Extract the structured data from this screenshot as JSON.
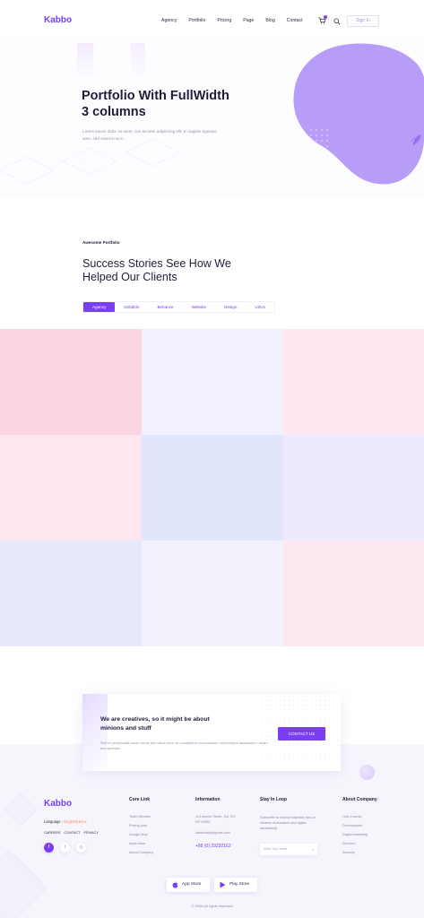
{
  "header": {
    "logo": "Kabbo",
    "nav": [
      "Agency",
      "Portfolio",
      "Pricing",
      "Page",
      "Blog",
      "Contact"
    ],
    "signin_label": "Sign In"
  },
  "hero": {
    "title": "Portfolio With FullWidth 3 columns",
    "description": "Lorem ipsum dolor sit amet, con sectetu adipiscing elit. In sagittis egestas ante, sed viverra nunc."
  },
  "portfolio": {
    "eyebrow": "Awesome Portfolio",
    "title": "Success Stories See How We Helped Our Clients",
    "filters": [
      "Agency",
      "Dribbble",
      "Behance",
      "Website",
      "Design",
      "UI/Ux"
    ],
    "active_filter": "Agency",
    "tiles": [
      "#fbd6e2",
      "#f0f1fc",
      "#fde6ee",
      "#fde6ef",
      "#e2e6fc",
      "#eee9fc",
      "#e6e8fc",
      "#f1f2fc",
      "#fde7ef"
    ]
  },
  "cta": {
    "title": "We are creatives, so it might be about minions and stuff",
    "description": "Sed ut perspiciatis unde omnis iste natus error sit voluptatem accusantium doloremque laudantium, totam rem aperiam",
    "button_label": "CONTACT US"
  },
  "footer": {
    "logo": "Kabbo",
    "language_label": "Language :",
    "language_value": "English(UK) ▾",
    "links": [
      "CAREERS",
      "CONTACT",
      "PRIVACY"
    ],
    "social": [
      {
        "icon": "facebook-icon",
        "glyph": "f"
      },
      {
        "icon": "twitter-icon",
        "glyph": "t"
      },
      {
        "icon": "instagram-icon",
        "glyph": "◎"
      }
    ],
    "core_link": {
      "title": "Core Link",
      "items": [
        "Team Member",
        "Pricing plan",
        "Google Map",
        "Apps store",
        "About Company"
      ]
    },
    "information": {
      "title": "Information",
      "address": "113 minnie Street, Sol 7Z3 NY 20052",
      "email": "kabbohelp@gmail.com",
      "phone": "+88 (0) 29292162"
    },
    "stay_in_loop": {
      "title": "Stay In Loop",
      "description": "Subscribe to receive biweekly tips on creative automation and digital advertising!",
      "email_placeholder": "Write Your email",
      "submit_icon": "arrow-right-icon"
    },
    "about_company": {
      "title": "About Company",
      "items": [
        "How it works",
        "Development",
        "Digital marketing",
        "Services",
        "Security"
      ]
    },
    "stores": {
      "app": "App Store",
      "play": "Play Store"
    },
    "copyright": "© 2018 All rights reserved"
  },
  "colors": {
    "accent": "#7b3ff2",
    "blob": "#b79cf8",
    "language_accent": "#ff8c5a"
  }
}
